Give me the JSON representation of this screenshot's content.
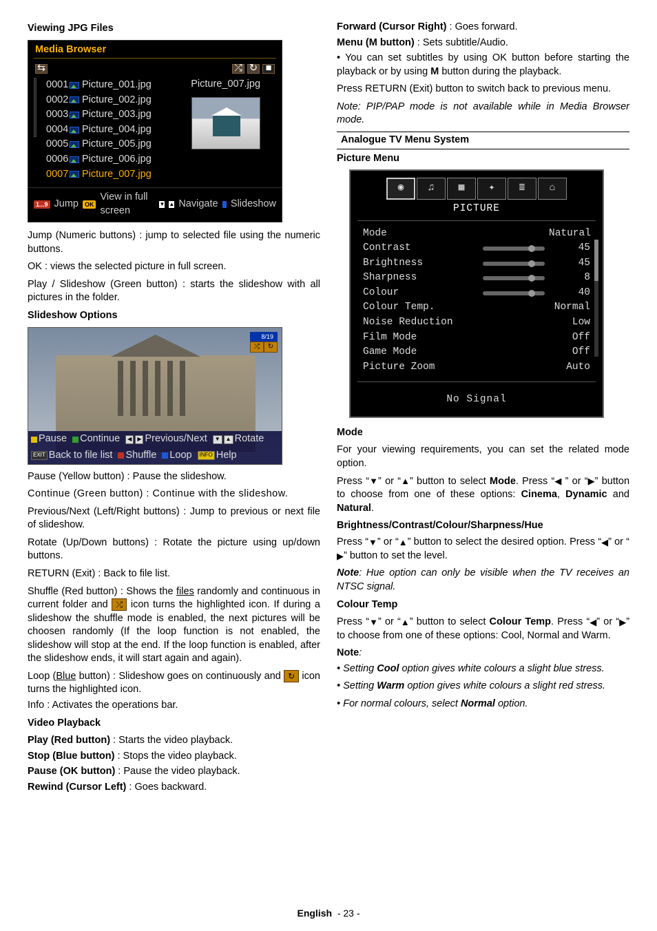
{
  "left": {
    "h_viewing": "Viewing JPG Files",
    "mb": {
      "title": "Media Browser",
      "files": [
        {
          "num": "0001.",
          "name": "Picture_001.jpg"
        },
        {
          "num": "0002.",
          "name": "Picture_002.jpg"
        },
        {
          "num": "0003.",
          "name": "Picture_003.jpg"
        },
        {
          "num": "0004.",
          "name": "Picture_004.jpg"
        },
        {
          "num": "0005.",
          "name": "Picture_005.jpg"
        },
        {
          "num": "0006.",
          "name": "Picture_006.jpg"
        },
        {
          "num": "0007.",
          "name": "Picture_007.jpg"
        }
      ],
      "preview_name": "Picture_007.jpg",
      "footer": {
        "jump_key": "1...9",
        "jump": "Jump",
        "ok": "OK",
        "ok_label": "View in full screen",
        "nav": "Navigate",
        "slide": "Slideshow"
      }
    },
    "p_jump": "Jump (Numeric buttons) : jump to selected file using the numeric buttons.",
    "p_ok": "OK : views the selected picture in full screen.",
    "p_play": "Play / Slideshow (Green button) : starts the slideshow with all pictures in the folder.",
    "h_slideshow": "Slideshow Options",
    "ss": {
      "count": "8/19",
      "bar": {
        "pause": "Pause",
        "cont": "Continue",
        "prevnext": "Previous/Next",
        "rotate": "Rotate",
        "back": "Back to file list",
        "shuffle": "Shuffle",
        "loop": "Loop",
        "help": "Help",
        "exit": "EXIT",
        "info": "INFO"
      }
    },
    "p_pause": "Pause (Yellow button) : Pause the slideshow.",
    "p_cont": "Continue (Green button) : Continue with the slideshow.",
    "p_prevnext": "Previous/Next (Left/Right buttons) : Jump to previous or next file of slideshow.",
    "p_rotate": "Rotate (Up/Down buttons) : Rotate the picture using up/down buttons.",
    "p_return": "RETURN (Exit) : Back to file list.",
    "p_shuffle_a": "Shuffle (Red button) : Shows the ",
    "p_shuffle_a_underline": "files",
    "p_shuffle_b": " randomly and continuous in current folder and ",
    "p_shuffle_c": " icon turns the highlighted icon. If during a slideshow the shuffle mode is enabled, the next pictures will be choosen randomly (If the loop function is not enabled, the slideshow will stop at the end. If the loop function is enabled, after the slideshow ends, it will start again and again).",
    "p_loop_a": "Loop (",
    "p_loop_a_underline": "Blue",
    "p_loop_b": " button) : Slideshow goes on continuously and ",
    "p_loop_c": " icon turns the highlighted icon.",
    "p_info": "Info : Activates the operations bar.",
    "h_video": "Video Playback",
    "vp_play_b": "Play (Red button)",
    "vp_play": " : Starts the video playback.",
    "vp_stop_b": "Stop (Blue button)",
    "vp_stop": " : Stops the video playback.",
    "vp_pause_b": "Pause (OK button)",
    "vp_pause": " : Pause the video playback.",
    "vp_rewind_b": "Rewind (Cursor Left)",
    "vp_rewind": " : Goes backward."
  },
  "right": {
    "vp_fwd_b": "Forward (Cursor Right)",
    "vp_fwd": " : Goes forward.",
    "vp_menu_b": "Menu (M button)",
    "vp_menu": " : Sets subtitle/Audio.",
    "p_subs_a": "• You can set subtitles by using OK button before starting the playback or by using ",
    "p_subs_m": "M",
    "p_subs_b": " button during the playback.",
    "p_return": "Press RETURN (Exit) button to switch back to previous menu.",
    "p_note_pip": "Note: PIP/PAP mode is not available while in Media Browser mode.",
    "h_analogue": "Analogue TV Menu System",
    "h_picture": "Picture Menu",
    "pm": {
      "label": "PICTURE",
      "rows": [
        {
          "k": "Mode",
          "v": "Natural",
          "slider": false
        },
        {
          "k": "Contrast",
          "v": "45",
          "slider": true
        },
        {
          "k": "Brightness",
          "v": "45",
          "slider": true
        },
        {
          "k": "Sharpness",
          "v": "8",
          "slider": true
        },
        {
          "k": "Colour",
          "v": "40",
          "slider": true
        },
        {
          "k": "Colour Temp.",
          "v": "Normal",
          "slider": false
        },
        {
          "k": "Noise Reduction",
          "v": "Low",
          "slider": false
        },
        {
          "k": "Film Mode",
          "v": "Off",
          "slider": false
        },
        {
          "k": "Game Mode",
          "v": "Off",
          "slider": false
        },
        {
          "k": "Picture Zoom",
          "v": "Auto",
          "slider": false
        }
      ],
      "nosignal": "No Signal"
    },
    "h_mode": "Mode",
    "p_mode1": "For your viewing requirements, you can set the related mode option.",
    "p_mode2_a": "Press “",
    "p_mode2_b": "” or “",
    "p_mode2_c": "” button to select ",
    "p_mode2_mode": "Mode",
    "p_mode2_d": ". Press “",
    "p_mode2_e": " ” or “",
    "p_mode2_f": "” button to choose from one of these options: ",
    "p_mode2_opts_a": "Cinema",
    "p_mode2_comma": ",  ",
    "p_mode2_opts_b": "Dynamic",
    "p_mode2_and": " and ",
    "p_mode2_opts_c": "Natural",
    "p_mode2_dot": ".",
    "h_bcch": "Brightness/Contrast/Colour/Sharpness/Hue",
    "p_bcch1_a": "Press “",
    "p_bcch1_b": "” or “",
    "p_bcch1_c": "” button to select the desired option. Press “",
    "p_bcch1_d": "” or “",
    "p_bcch1_e": "” button to set the level.",
    "p_hue_note_a": "Note",
    "p_hue_note_b": ": Hue option can only be visible when the TV receives an NTSC signal.",
    "h_ctemp": "Colour Temp",
    "p_ct_a": "Press “",
    "p_ct_b": "” or “",
    "p_ct_c": "” button to select ",
    "p_ct_bold": "Colour Temp",
    "p_ct_d": ". Press “",
    "p_ct_e": "” or “",
    "p_ct_f": "” to choose from one of these options: Cool, Normal and Warm.",
    "note_hdr": "Note",
    "note_colon": ":",
    "n1_a": "• Setting ",
    "n1_b": "Cool",
    "n1_c": " option gives white colours a slight blue stress.",
    "n2_a": "• Setting ",
    "n2_b": "Warm",
    "n2_c": " option gives white colours a slight red stress.",
    "n3_a": "• For normal colours, select ",
    "n3_b": "Normal",
    "n3_c": " option."
  },
  "footer": {
    "lang": "English",
    "page": "- 23 -"
  },
  "arrows": {
    "down": "▼",
    "up": "▲",
    "left": "◀",
    "right": "▶"
  }
}
